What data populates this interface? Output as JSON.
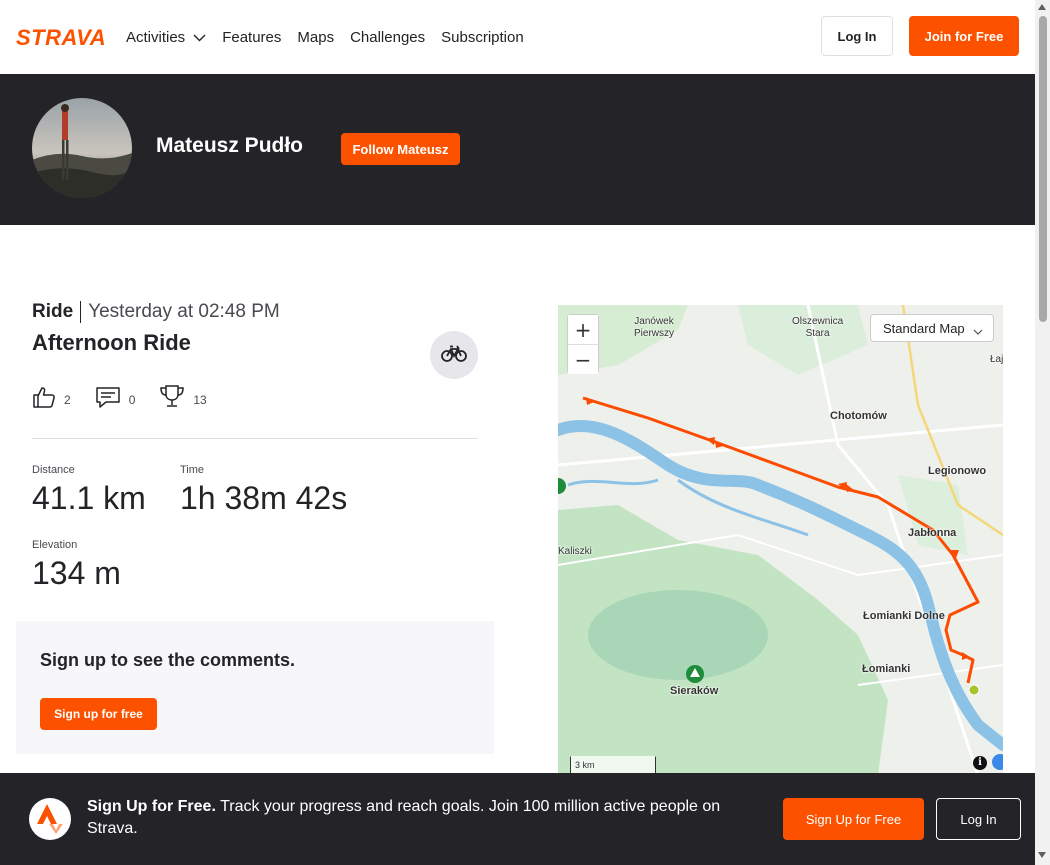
{
  "header": {
    "logo_text": "STRAVA",
    "nav": [
      {
        "label": "Activities",
        "has_dropdown": true
      },
      {
        "label": "Features"
      },
      {
        "label": "Maps"
      },
      {
        "label": "Challenges"
      },
      {
        "label": "Subscription"
      }
    ],
    "login_label": "Log In",
    "join_label": "Join for Free"
  },
  "athlete": {
    "name": "Mateusz Pudło",
    "follow_label": "Follow Mateusz"
  },
  "activity": {
    "type": "Ride",
    "date": "Yesterday at 02:48 PM",
    "title": "Afternoon Ride",
    "sport_icon": "bike-icon",
    "kudos": "2",
    "comments": "0",
    "achievements": "13",
    "stats": {
      "distance_label": "Distance",
      "distance_value": "41.1 km",
      "time_label": "Time",
      "time_value": "1h 38m 42s",
      "elevation_label": "Elevation",
      "elevation_value": "134 m"
    }
  },
  "comments_panel": {
    "title": "Sign up to see the comments.",
    "signup_label": "Sign up for free"
  },
  "map": {
    "zoom_in": "+",
    "zoom_out": "−",
    "style_label": "Standard Map",
    "scale_label": "3 km",
    "info_label": "i",
    "labels": {
      "janowek": "Janówek\nPierwszy",
      "olszewnica": "Olszewnica\nStara",
      "lajski": "Łaj",
      "chotomow": "Chotomów",
      "legionowo": "Legionowo",
      "jablonna": "Jabłonna",
      "kaliszki": "Kaliszki",
      "lomianki_dolne": "Łomianki Dolne",
      "lomianki": "Łomianki",
      "sierakow": "Sieraków"
    },
    "colors": {
      "route": "#fc4c02",
      "river": "#7fb7dd",
      "forest": "#bfe3c0",
      "land": "#eef0ec"
    }
  },
  "signup_bar": {
    "headline": "Sign Up for Free.",
    "text": "Track your progress and reach goals. Join 100 million active people on Strava.",
    "signup_label": "Sign Up for Free",
    "login_label": "Log In"
  },
  "colors": {
    "brand": "#fc5200",
    "dark": "#242428"
  }
}
